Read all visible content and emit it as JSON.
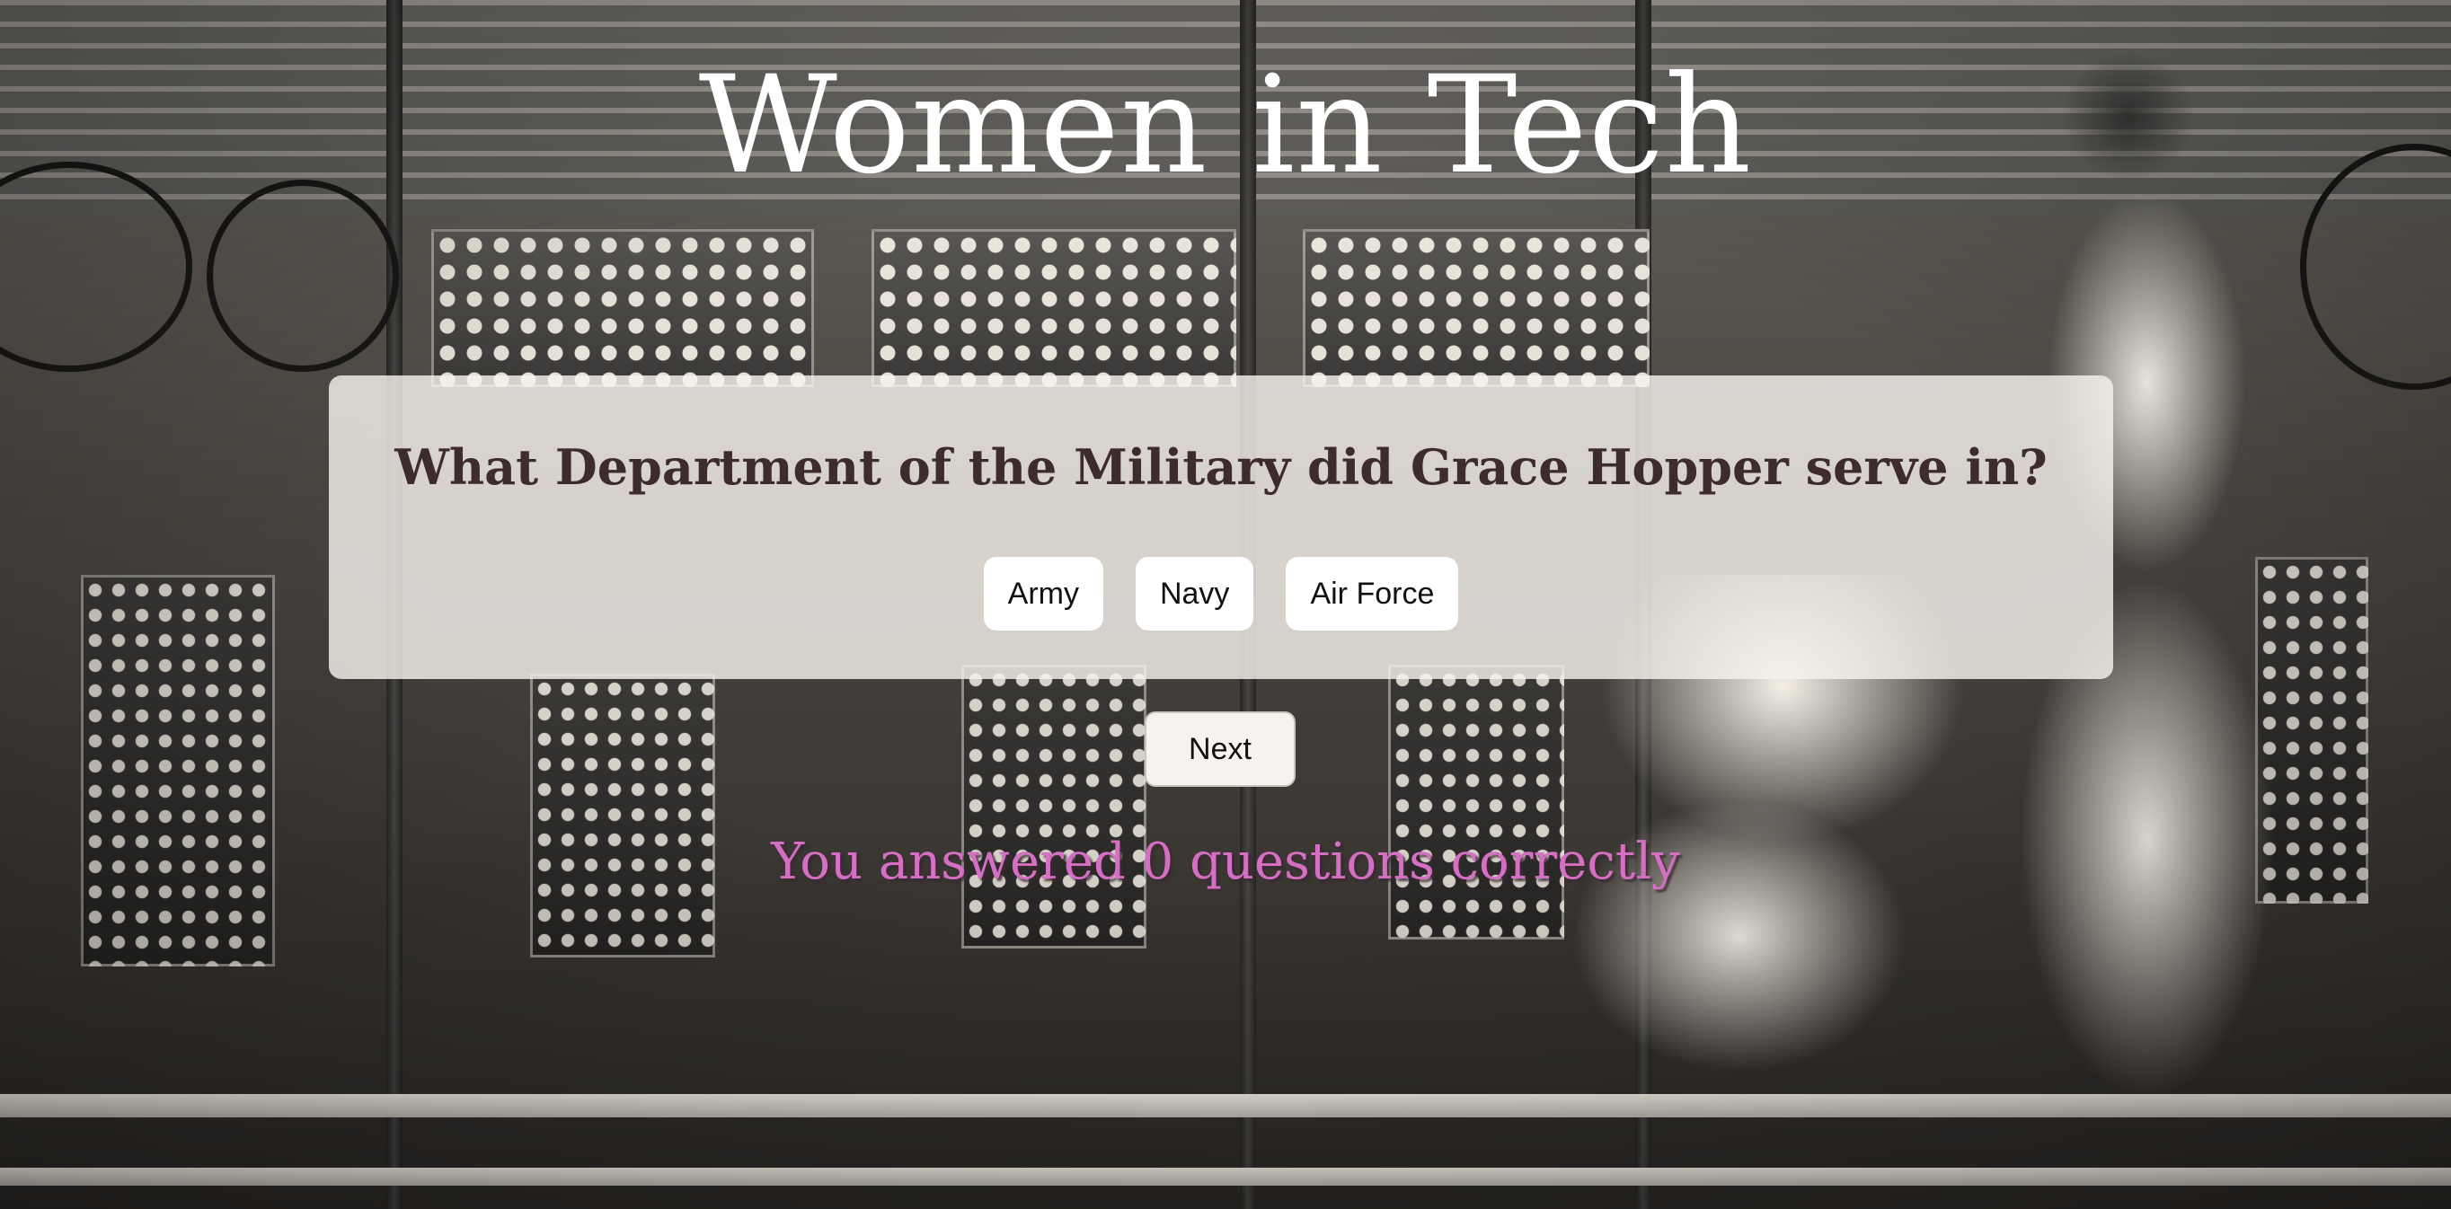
{
  "page": {
    "title": "Women in Tech"
  },
  "quiz": {
    "question": "What Department of the Military did Grace Hopper serve in?",
    "answers": [
      "Army",
      "Navy",
      "Air Force"
    ],
    "next_label": "Next",
    "score_text": "You answered 0 questions correctly"
  },
  "colors": {
    "title_text": "#ffffff",
    "question_text": "#3e2b2e",
    "score_text": "#d46fc4",
    "card_background": "#f6f2ec"
  },
  "background": {
    "image_icon": "vintage-computer-photo"
  }
}
